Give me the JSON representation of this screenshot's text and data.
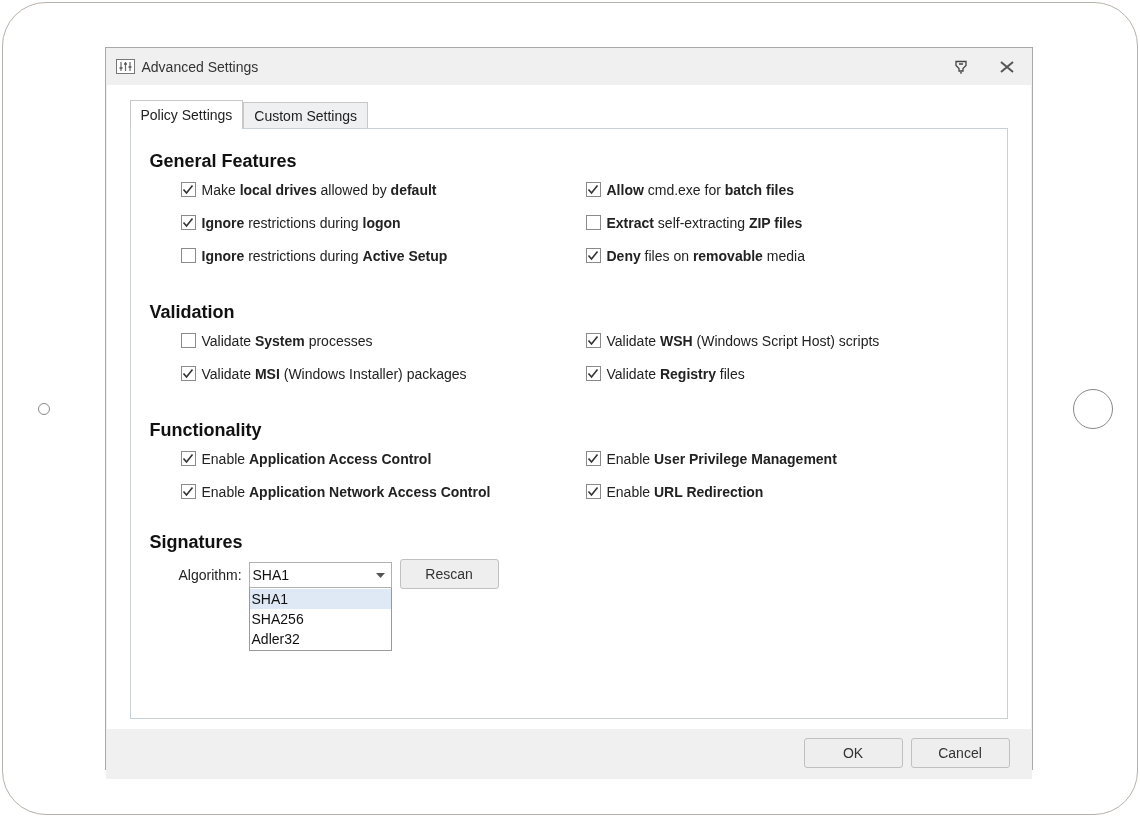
{
  "window": {
    "title": "Advanced Settings"
  },
  "tabs": [
    {
      "label": "Policy Settings",
      "selected": true
    },
    {
      "label": "Custom Settings",
      "selected": false
    }
  ],
  "sections": [
    {
      "title": "General Features",
      "items": [
        {
          "label": "Make **local drives** allowed by **default**",
          "checked": true
        },
        {
          "label": "**Allow** cmd.exe for **batch files**",
          "checked": true
        },
        {
          "label": "**Ignore** restrictions during **logon**",
          "checked": true
        },
        {
          "label": "**Extract** self-extracting **ZIP files**",
          "checked": false
        },
        {
          "label": "**Ignore** restrictions during **Active Setup**",
          "checked": false
        },
        {
          "label": "**Deny** files on **removable** media",
          "checked": true
        }
      ]
    },
    {
      "title": "Validation",
      "items": [
        {
          "label": "Validate **System** processes",
          "checked": false
        },
        {
          "label": "Validate **WSH** (Windows Script Host) scripts",
          "checked": true
        },
        {
          "label": "Validate **MSI** (Windows Installer) packages",
          "checked": true
        },
        {
          "label": "Validate **Registry** files",
          "checked": true
        }
      ]
    },
    {
      "title": "Functionality",
      "items": [
        {
          "label": "Enable **Application Access Control**",
          "checked": true
        },
        {
          "label": "Enable **User Privilege Management**",
          "checked": true
        },
        {
          "label": "Enable **Application Network Access Control**",
          "checked": true
        },
        {
          "label": "Enable **URL Redirection**",
          "checked": true
        }
      ]
    }
  ],
  "signatures": {
    "title": "Signatures",
    "algorithm_label": "Algorithm:",
    "algorithm_value": "SHA1",
    "options": [
      {
        "label": "SHA1",
        "selected": true
      },
      {
        "label": "SHA256",
        "selected": false
      },
      {
        "label": "Adler32",
        "selected": false
      }
    ],
    "rescan_button": "Rescan"
  },
  "buttons": [
    "OK",
    "Cancel"
  ]
}
